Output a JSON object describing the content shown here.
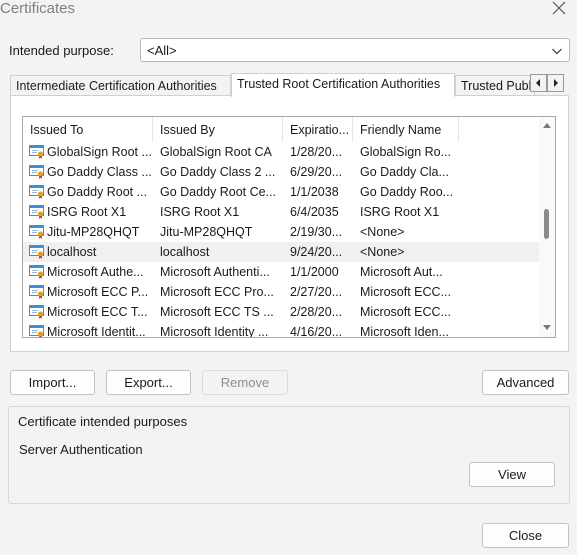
{
  "window": {
    "title": "Certificates"
  },
  "purpose": {
    "label": "Intended purpose:",
    "value": "<All>"
  },
  "tabs": [
    {
      "label": "Intermediate Certification Authorities",
      "active": false
    },
    {
      "label": "Trusted Root Certification Authorities",
      "active": true
    },
    {
      "label": "Trusted Publishers",
      "active": false
    }
  ],
  "list": {
    "columns": [
      "Issued To",
      "Issued By",
      "Expiratio...",
      "Friendly Name"
    ],
    "rows": [
      {
        "issued_to": "GlobalSign Root ...",
        "issued_by": "GlobalSign Root CA",
        "expiration": "1/28/20...",
        "friendly": "GlobalSign Ro...",
        "selected": false
      },
      {
        "issued_to": "Go Daddy Class ...",
        "issued_by": "Go Daddy Class 2 ...",
        "expiration": "6/29/20...",
        "friendly": "Go Daddy Cla...",
        "selected": false
      },
      {
        "issued_to": "Go Daddy Root ...",
        "issued_by": "Go Daddy Root Ce...",
        "expiration": "1/1/2038",
        "friendly": "Go Daddy Roo...",
        "selected": false
      },
      {
        "issued_to": "ISRG Root X1",
        "issued_by": "ISRG Root X1",
        "expiration": "6/4/2035",
        "friendly": "ISRG Root X1",
        "selected": false
      },
      {
        "issued_to": "Jitu-MP28QHQT",
        "issued_by": "Jitu-MP28QHQT",
        "expiration": "2/19/30...",
        "friendly": "<None>",
        "selected": false
      },
      {
        "issued_to": "localhost",
        "issued_by": "localhost",
        "expiration": "9/24/20...",
        "friendly": "<None>",
        "selected": true
      },
      {
        "issued_to": "Microsoft Authe...",
        "issued_by": "Microsoft Authenti...",
        "expiration": "1/1/2000",
        "friendly": "Microsoft Aut...",
        "selected": false
      },
      {
        "issued_to": "Microsoft ECC P...",
        "issued_by": "Microsoft ECC Pro...",
        "expiration": "2/27/20...",
        "friendly": "Microsoft ECC...",
        "selected": false
      },
      {
        "issued_to": "Microsoft ECC T...",
        "issued_by": "Microsoft ECC TS ...",
        "expiration": "2/28/20...",
        "friendly": "Microsoft ECC...",
        "selected": false
      },
      {
        "issued_to": "Microsoft Identit...",
        "issued_by": "Microsoft Identity ...",
        "expiration": "4/16/20...",
        "friendly": "Microsoft Iden...",
        "selected": false
      }
    ]
  },
  "buttons": {
    "import": "Import...",
    "export": "Export...",
    "remove": "Remove",
    "advanced": "Advanced",
    "view": "View",
    "close": "Close"
  },
  "purposes_group": {
    "title": "Certificate intended purposes",
    "text": "Server Authentication"
  },
  "colors": {
    "selected_row": "#f0f0f0",
    "cert_icon": "#3a8fd6",
    "seal": "#e0a21c",
    "disabled_text": "#8d8d8d"
  }
}
